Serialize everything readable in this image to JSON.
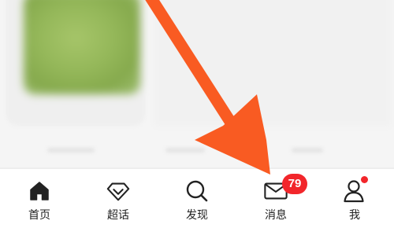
{
  "colors": {
    "badge": "#f2262b",
    "arrow": "#f95b22",
    "tab_text": "#222222"
  },
  "tabs": [
    {
      "label": "首页",
      "icon": "home-icon"
    },
    {
      "label": "超话",
      "icon": "diamond-icon"
    },
    {
      "label": "发现",
      "icon": "search-icon"
    },
    {
      "label": "消息",
      "icon": "mail-icon",
      "badge": "79"
    },
    {
      "label": "我",
      "icon": "person-icon",
      "has_dot": true
    }
  ]
}
